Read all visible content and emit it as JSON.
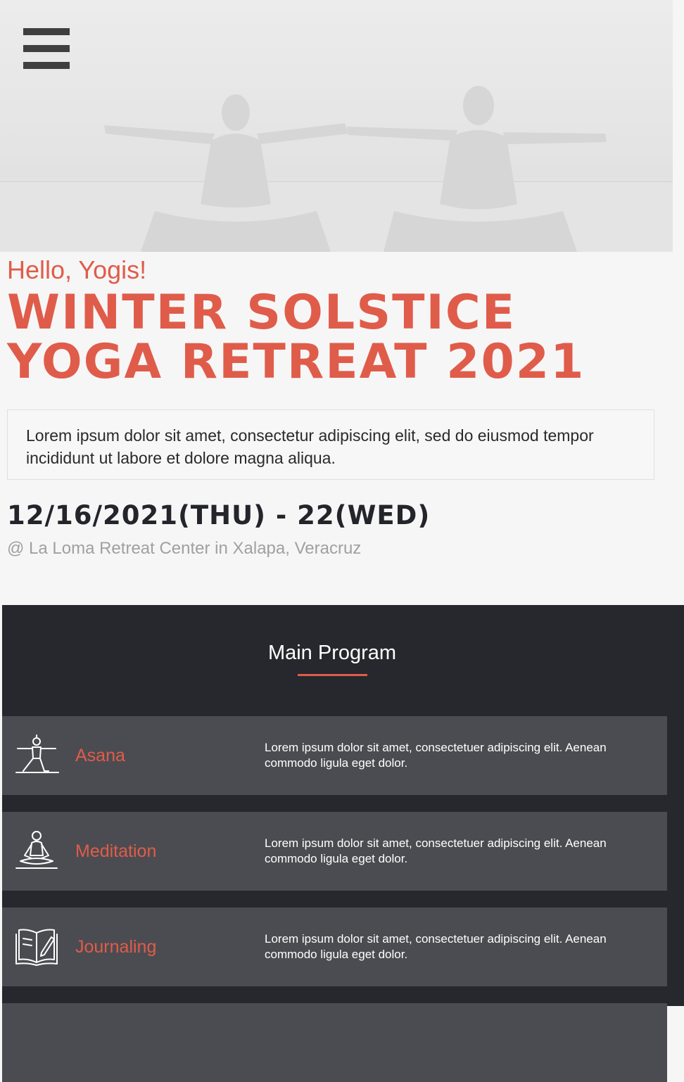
{
  "header": {
    "menu_icon": "hamburger-menu-icon",
    "hero_image": "two-yogis-on-beach-silhouette"
  },
  "hero": {
    "greeting": "Hello, Yogis!",
    "title": "WINTER SOLSTICE YOGA RETREAT 2021",
    "intro": "Lorem ipsum dolor sit amet, consectetur adipiscing elit, sed do eiusmod tempor incididunt ut labore et dolore magna aliqua.",
    "dates": "12/16/2021(THU) - 22(WED)",
    "location": "@ La Loma Retreat Center in Xalapa, Veracruz"
  },
  "program": {
    "title": "Main Program",
    "items": [
      {
        "icon": "yoga-pose-icon",
        "label": "Asana",
        "description": "Lorem ipsum dolor sit amet, consectetuer adipiscing elit. Aenean commodo ligula eget dolor."
      },
      {
        "icon": "meditation-icon",
        "label": "Meditation",
        "description": "Lorem ipsum dolor sit amet, consectetuer adipiscing elit. Aenean commodo ligula eget dolor."
      },
      {
        "icon": "journal-book-icon",
        "label": "Journaling",
        "description": "Lorem ipsum dolor sit amet, consectetuer adipiscing elit. Aenean commodo ligula eget dolor."
      }
    ]
  },
  "colors": {
    "accent": "#e05c4a",
    "dark_section": "#27282d",
    "card": "#4b4c51",
    "page_bg": "#f6f6f6"
  }
}
